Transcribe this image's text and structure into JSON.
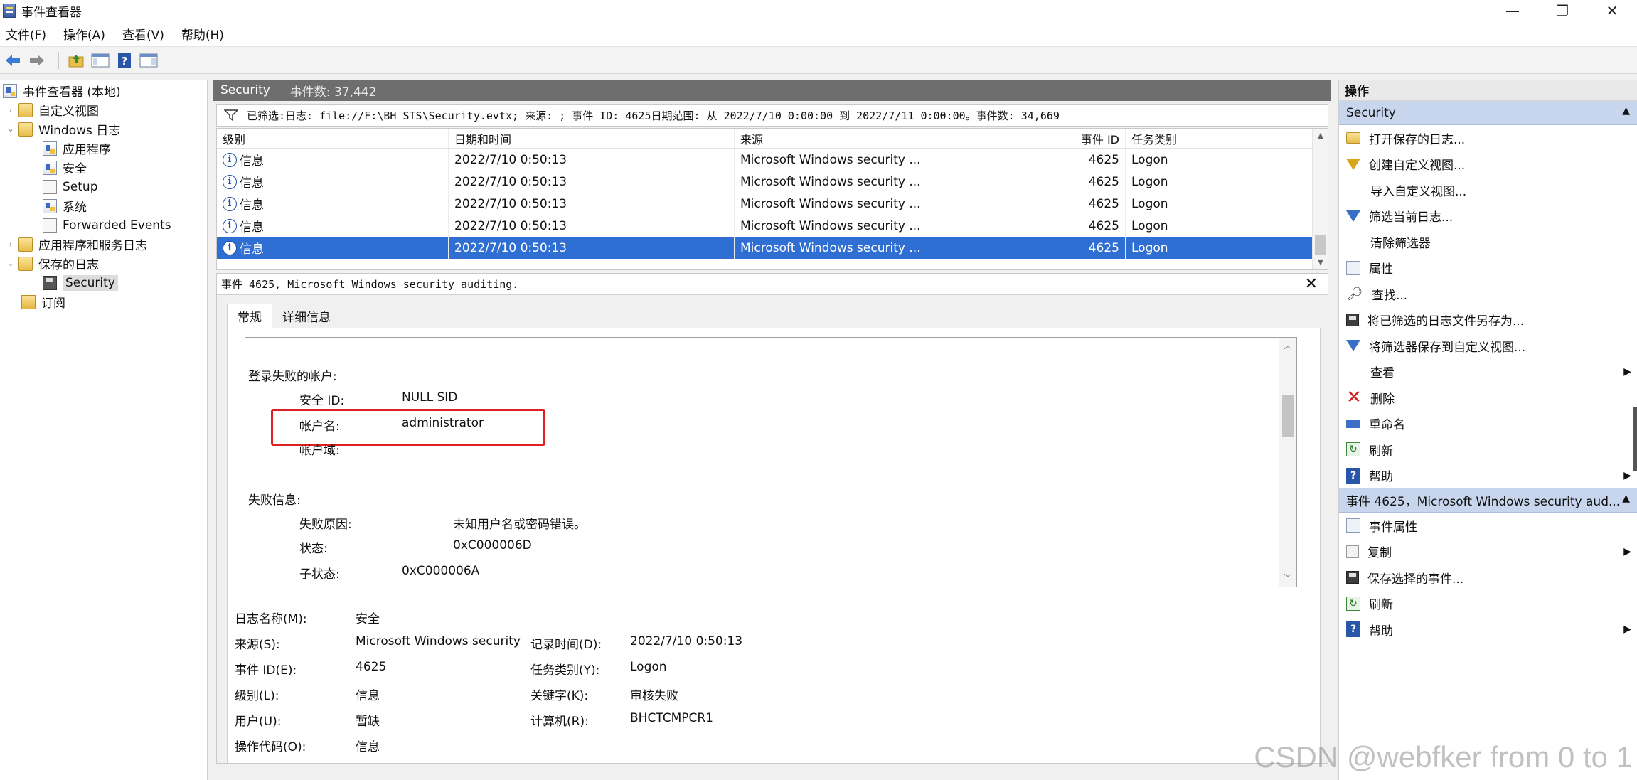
{
  "window": {
    "title": "事件查看器",
    "min": "—",
    "max": "❐",
    "close": "✕"
  },
  "menu": [
    "文件(F)",
    "操作(A)",
    "查看(V)",
    "帮助(H)"
  ],
  "tree": {
    "root": "事件查看器 (本地)",
    "custom_views": "自定义视图",
    "windows_logs": "Windows 日志",
    "application": "应用程序",
    "security": "安全",
    "setup": "Setup",
    "system": "系统",
    "forwarded": "Forwarded Events",
    "app_service_logs": "应用程序和服务日志",
    "saved_logs": "保存的日志",
    "saved_security": "Security",
    "subscriptions": "订阅"
  },
  "center": {
    "header_title": "Security",
    "header_count": "事件数: 37,442",
    "filter_text": "已筛选:日志: file://F:\\BH STS\\Security.evtx; 来源: ; 事件 ID: 4625日期范围: 从 2022/7/10 0:00:00 到 2022/7/11 0:00:00。事件数: 34,669",
    "columns": {
      "level": "级别",
      "date": "日期和时间",
      "source": "来源",
      "event_id": "事件 ID",
      "task": "任务类别"
    },
    "rows": [
      {
        "level": "信息",
        "date": "2022/7/10 0:50:13",
        "source": "Microsoft Windows security ...",
        "event_id": "4625",
        "task": "Logon"
      },
      {
        "level": "信息",
        "date": "2022/7/10 0:50:13",
        "source": "Microsoft Windows security ...",
        "event_id": "4625",
        "task": "Logon"
      },
      {
        "level": "信息",
        "date": "2022/7/10 0:50:13",
        "source": "Microsoft Windows security ...",
        "event_id": "4625",
        "task": "Logon"
      },
      {
        "level": "信息",
        "date": "2022/7/10 0:50:13",
        "source": "Microsoft Windows security ...",
        "event_id": "4625",
        "task": "Logon"
      },
      {
        "level": "信息",
        "date": "2022/7/10 0:50:13",
        "source": "Microsoft Windows security ...",
        "event_id": "4625",
        "task": "Logon"
      }
    ],
    "selected_row": 4
  },
  "detail": {
    "title": "事件 4625, Microsoft Windows security auditing.",
    "close": "✕",
    "tab_general": "常规",
    "tab_details": "详细信息",
    "desc": {
      "failed_account": "登录失败的帐户:",
      "sid_label": "安全 ID:",
      "sid_value": "NULL SID",
      "account_label": "帐户名:",
      "account_value": "administrator",
      "domain_label": "帐户域:",
      "failure_info": "失败信息:",
      "reason_label": "失败原因:",
      "reason_value": "未知用户名或密码错误。",
      "status_label": "状态:",
      "status_value": "0xC000006D",
      "substatus_label": "子状态:",
      "substatus_value": "0xC000006A"
    },
    "props": {
      "log_name_label": "日志名称(M):",
      "log_name_value": "安全",
      "source_label": "来源(S):",
      "source_value": "Microsoft Windows security",
      "logged_label": "记录时间(D):",
      "logged_value": "2022/7/10 0:50:13",
      "event_id_label": "事件 ID(E):",
      "event_id_value": "4625",
      "task_label": "任务类别(Y):",
      "task_value": "Logon",
      "level_label": "级别(L):",
      "level_value": "信息",
      "keywords_label": "关键字(K):",
      "keywords_value": "审核失败",
      "user_label": "用户(U):",
      "user_value": "暂缺",
      "computer_label": "计算机(R):",
      "computer_value": "BHCTCMPCR1",
      "opcode_label": "操作代码(O):",
      "opcode_value": "信息"
    }
  },
  "actions": {
    "header": "操作",
    "section1": "Security",
    "items1": [
      {
        "label": "打开保存的日志...",
        "icon": "open-log-icon"
      },
      {
        "label": "创建自定义视图...",
        "icon": "create-view-icon"
      },
      {
        "label": "导入自定义视图...",
        "icon": ""
      },
      {
        "label": "筛选当前日志...",
        "icon": "filter-icon"
      },
      {
        "label": "清除筛选器",
        "icon": ""
      },
      {
        "label": "属性",
        "icon": "properties-icon"
      },
      {
        "label": "查找...",
        "icon": "find-icon"
      },
      {
        "label": "将已筛选的日志文件另存为...",
        "icon": "save-icon"
      },
      {
        "label": "将筛选器保存到自定义视图...",
        "icon": "save-filter-icon"
      },
      {
        "label": "查看",
        "icon": "",
        "submenu": true
      },
      {
        "label": "删除",
        "icon": "delete-icon"
      },
      {
        "label": "重命名",
        "icon": "rename-icon"
      },
      {
        "label": "刷新",
        "icon": "refresh-icon"
      },
      {
        "label": "帮助",
        "icon": "help-icon",
        "submenu": true
      }
    ],
    "section2": "事件 4625，Microsoft Windows security aud...",
    "items2": [
      {
        "label": "事件属性",
        "icon": "event-properties-icon"
      },
      {
        "label": "复制",
        "icon": "copy-icon",
        "submenu": true
      },
      {
        "label": "保存选择的事件...",
        "icon": "save-icon"
      },
      {
        "label": "刷新",
        "icon": "refresh-icon"
      },
      {
        "label": "帮助",
        "icon": "help-icon",
        "submenu": true
      }
    ]
  },
  "watermark": "CSDN @webfker from 0 to 1",
  "colors": {
    "selection": "#2f6fd3",
    "section_header": "#c7d6ed",
    "highlight": "#e02020",
    "panel_header": "#6e6e6e"
  }
}
